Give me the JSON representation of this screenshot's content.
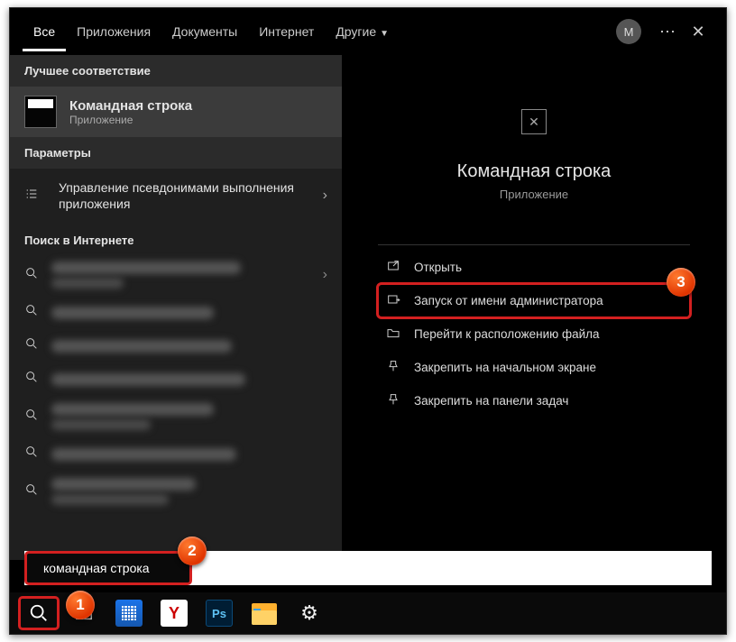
{
  "tabs": {
    "items": [
      "Все",
      "Приложения",
      "Документы",
      "Интернет",
      "Другие"
    ],
    "account_initial": "M"
  },
  "sections": {
    "best_match": "Лучшее соответствие",
    "settings": "Параметры",
    "web": "Поиск в Интернете"
  },
  "best_match": {
    "title": "Командная строка",
    "subtitle": "Приложение"
  },
  "settings_row": {
    "text": "Управление псевдонимами выполнения приложения"
  },
  "preview": {
    "title": "Командная строка",
    "subtitle": "Приложение"
  },
  "actions": [
    "Открыть",
    "Запуск от имени администратора",
    "Перейти к расположению файла",
    "Закрепить на начальном экране",
    "Закрепить на панели задач"
  ],
  "search": {
    "value": "командная строка"
  },
  "markers": [
    "1",
    "2",
    "3"
  ],
  "taskbar_apps": [
    "calendar",
    "yandex",
    "photoshop",
    "explorer",
    "settings"
  ]
}
